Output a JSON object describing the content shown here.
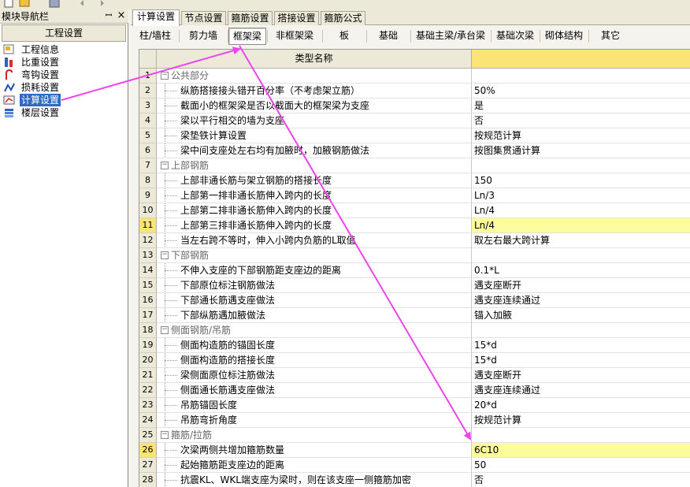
{
  "nav": {
    "title": "模块导航栏",
    "pin": "ꟷ",
    "close": "×",
    "header": "工程设置",
    "items": [
      {
        "label": "工程信息",
        "icon": "project-info-icon"
      },
      {
        "label": "比重设置",
        "icon": "weight-icon"
      },
      {
        "label": "弯钩设置",
        "icon": "hook-icon"
      },
      {
        "label": "损耗设置",
        "icon": "loss-icon"
      },
      {
        "label": "计算设置",
        "icon": "calc-icon",
        "selected": true
      },
      {
        "label": "楼层设置",
        "icon": "floor-icon"
      }
    ]
  },
  "tabs": [
    "计算设置",
    "节点设置",
    "箍筋设置",
    "搭接设置",
    "箍筋公式"
  ],
  "active_tab": 0,
  "subtabs": [
    "柱/墙柱",
    "剪力墙",
    "框架梁",
    "非框架梁",
    "板",
    "基础",
    "基础主梁/承台梁",
    "基础次梁",
    "砌体结构",
    "其它"
  ],
  "active_subtab": 2,
  "grid": {
    "header_name": "类型名称",
    "rows": [
      {
        "num": "1",
        "name": "公共部分",
        "value": "",
        "group": true
      },
      {
        "num": "2",
        "name": "纵筋搭接接头错开百分率（不考虑架立筋）",
        "value": "50%"
      },
      {
        "num": "3",
        "name": "截面小的框架梁是否以截面大的框架梁为支座",
        "value": "是"
      },
      {
        "num": "4",
        "name": "梁以平行相交的墙为支座",
        "value": "否"
      },
      {
        "num": "5",
        "name": "梁垫铁计算设置",
        "value": "按规范计算"
      },
      {
        "num": "6",
        "name": "梁中间支座处左右均有加腋时，加腋钢筋做法",
        "value": "按图集贯通计算"
      },
      {
        "num": "7",
        "name": "上部钢筋",
        "value": "",
        "group": true
      },
      {
        "num": "8",
        "name": "上部非通长筋与架立钢筋的搭接长度",
        "value": "150"
      },
      {
        "num": "9",
        "name": "上部第一排非通长筋伸入跨内的长度",
        "value": "Ln/3"
      },
      {
        "num": "10",
        "name": "上部第二排非通长筋伸入跨内的长度",
        "value": "Ln/4"
      },
      {
        "num": "11",
        "name": "上部第三排非通长筋伸入跨内的长度",
        "value": "Ln/4",
        "selected": true
      },
      {
        "num": "12",
        "name": "当左右跨不等时，伸入小跨内负筋的L取值",
        "value": "取左右最大跨计算"
      },
      {
        "num": "13",
        "name": "下部钢筋",
        "value": "",
        "group": true
      },
      {
        "num": "14",
        "name": "不伸入支座的下部钢筋距支座边的距离",
        "value": "0.1*L"
      },
      {
        "num": "15",
        "name": "下部原位标注钢筋做法",
        "value": "遇支座断开"
      },
      {
        "num": "16",
        "name": "下部通长筋遇支座做法",
        "value": "遇支座连续通过"
      },
      {
        "num": "17",
        "name": "下部纵筋遇加腋做法",
        "value": "锚入加腋"
      },
      {
        "num": "18",
        "name": "侧面钢筋/吊筋",
        "value": "",
        "group": true
      },
      {
        "num": "19",
        "name": "侧面构造筋的锚固长度",
        "value": "15*d"
      },
      {
        "num": "20",
        "name": "侧面构造筋的搭接长度",
        "value": "15*d"
      },
      {
        "num": "21",
        "name": "梁侧面原位标注筋做法",
        "value": "遇支座断开"
      },
      {
        "num": "22",
        "name": "侧面通长筋遇支座做法",
        "value": "遇支座连续通过"
      },
      {
        "num": "23",
        "name": "吊筋锚固长度",
        "value": "20*d"
      },
      {
        "num": "24",
        "name": "吊筋弯折角度",
        "value": "按规范计算"
      },
      {
        "num": "25",
        "name": "箍筋/拉筋",
        "value": "",
        "group": true
      },
      {
        "num": "26",
        "name": "次梁两侧共增加箍筋数量",
        "value": "6C10",
        "selected": true
      },
      {
        "num": "27",
        "name": "起始箍筋距支座边的距离",
        "value": "50"
      },
      {
        "num": "28",
        "name": "抗震KL、WKL端支座为梁时，则在该支座一侧箍筋加密",
        "value": "否"
      }
    ]
  },
  "colors": {
    "arrow": "#ee44ee",
    "selection": "#316ac5",
    "highlight": "#fcfc9c"
  }
}
